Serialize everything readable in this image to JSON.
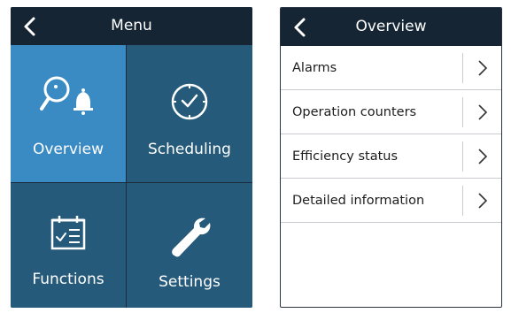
{
  "menu_screen": {
    "title": "Menu",
    "tiles": [
      {
        "label": "Overview",
        "icon": "overview-icon",
        "active": true
      },
      {
        "label": "Scheduling",
        "icon": "clock-icon",
        "active": false
      },
      {
        "label": "Functions",
        "icon": "calendar-checklist-icon",
        "active": false
      },
      {
        "label": "Settings",
        "icon": "wrench-icon",
        "active": false
      }
    ]
  },
  "overview_screen": {
    "title": "Overview",
    "items": [
      {
        "label": "Alarms"
      },
      {
        "label": "Operation counters"
      },
      {
        "label": "Efficiency status"
      },
      {
        "label": "Detailed information"
      }
    ]
  },
  "colors": {
    "header_bg": "#152533",
    "tile_bg": "#265a7b",
    "tile_active_bg": "#3a8ac4",
    "text_light": "#ffffff",
    "list_text": "#1d1d1d"
  }
}
